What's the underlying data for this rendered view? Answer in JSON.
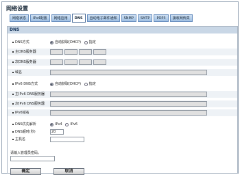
{
  "page_title": "网络设置",
  "tabs": [
    {
      "label": "网络状态",
      "active": false
    },
    {
      "label": "IPv4配置",
      "active": false
    },
    {
      "label": "网络应用",
      "active": false
    },
    {
      "label": "DNS",
      "active": true
    },
    {
      "label": "自动电子邮件通知",
      "active": false
    },
    {
      "label": "SNMP",
      "active": false
    },
    {
      "label": "SMTP",
      "active": false
    },
    {
      "label": "POP3",
      "active": false
    },
    {
      "label": "接收网传真",
      "active": false
    }
  ],
  "section": {
    "title": "DNS"
  },
  "dns": {
    "method_label": "DNS方式",
    "auto_option": "自动获取(DHCP)",
    "manual_option": "指定",
    "primary_label": "主DNS服务器",
    "secondary_label": "次DNS服务器",
    "domain_label": "域名"
  },
  "ipv6": {
    "method_label": "IPv6 DNS方式",
    "auto_option": "自动获取(DHCP)",
    "manual_option": "指定",
    "primary_label": "主IPv6 DNS服务器",
    "secondary_label": "次IPv6 DNS服务器",
    "domain_label": "IPv6域名"
  },
  "priority": {
    "label": "DNS优先解析",
    "option_ipv4": "IPv4",
    "option_ipv6": "IPv6"
  },
  "timeout": {
    "label": "DNS超时(秒)",
    "value": "20"
  },
  "host": {
    "label": "主机名",
    "value": ""
  },
  "password_prompt": "请输入管理员密码。",
  "buttons": {
    "ok": "确定",
    "cancel": "取消"
  }
}
